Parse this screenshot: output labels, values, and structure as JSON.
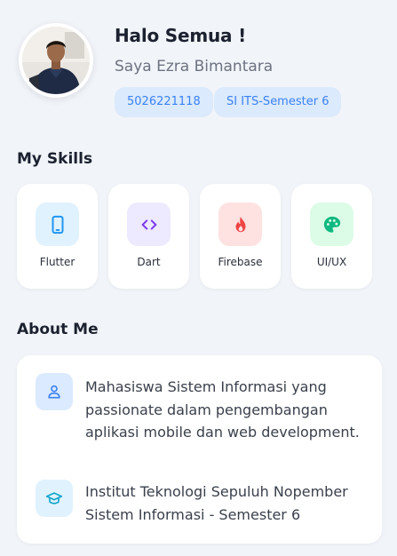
{
  "profile": {
    "greeting": "Halo Semua !",
    "name": "Saya Ezra Bimantara",
    "chips": [
      {
        "label": "5026221118"
      },
      {
        "label": "SI ITS-Semester 6"
      }
    ],
    "avatar_icon": "person-photo"
  },
  "skills": {
    "title": "My Skills",
    "items": [
      {
        "label": "Flutter",
        "icon": "smartphone-icon",
        "color": "#2196f3",
        "bg": "#e0f2fe"
      },
      {
        "label": "Dart",
        "icon": "code-icon",
        "color": "#7c3aed",
        "bg": "#ede9fe"
      },
      {
        "label": "Firebase",
        "icon": "flame-icon",
        "color": "#ef4444",
        "bg": "#fee2e2"
      },
      {
        "label": "UI/UX",
        "icon": "palette-icon",
        "color": "#10b981",
        "bg": "#dcfce7"
      }
    ]
  },
  "about": {
    "title": "About Me",
    "items": [
      {
        "icon": "person-icon",
        "text": "Mahasiswa Sistem Informasi yang passionate dalam pengembangan aplikasi mobile dan web development."
      },
      {
        "icon": "graduation-cap-icon",
        "text": "Institut Teknologi Sepuluh Nopember Sistem Informasi - Semester 6"
      }
    ]
  },
  "colors": {
    "background": "#f1f4f8",
    "card": "#ffffff",
    "chip_bg": "#dbeafc",
    "chip_text": "#3b82f6",
    "about_icon_bg_1": "#dbeafe",
    "about_icon_bg_2": "#e0f2fe"
  }
}
